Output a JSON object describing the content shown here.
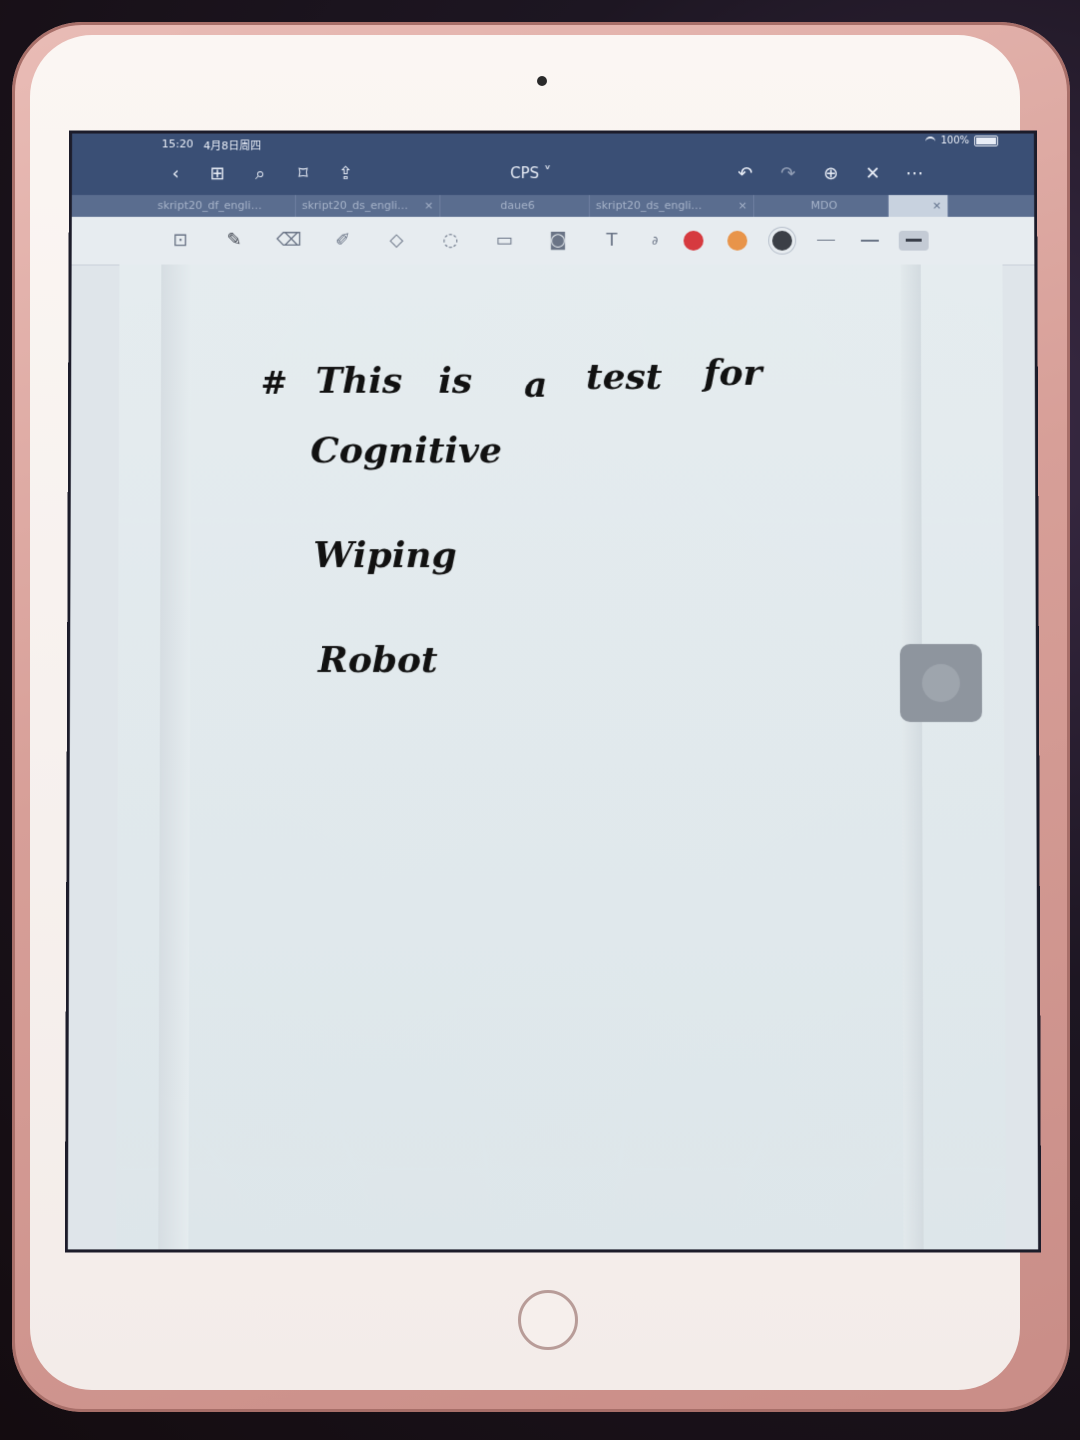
{
  "status_bar": {
    "time": "15:20",
    "date": "4月8日周四",
    "battery": "100%"
  },
  "navbar": {
    "document_title": "CPS ˅"
  },
  "tabs": [
    {
      "label": "skript20_df_engli…",
      "close": "×"
    },
    {
      "label": "skript20_ds_engli…",
      "close": "×"
    },
    {
      "label": "daue6",
      "close": ""
    },
    {
      "label": "skript20_ds_engli…",
      "close": "×"
    },
    {
      "label": "MDO",
      "close": ""
    },
    {
      "label": "",
      "close": "×"
    }
  ],
  "toolbar": {
    "colors": [
      "#d63a3f",
      "#e8944a",
      "#3b3f46"
    ]
  },
  "note": {
    "line1": [
      "#",
      "This",
      "is",
      "a",
      "test",
      "for"
    ],
    "line2": "Cognitive",
    "line3": "Wiping",
    "line4": "Robot"
  }
}
